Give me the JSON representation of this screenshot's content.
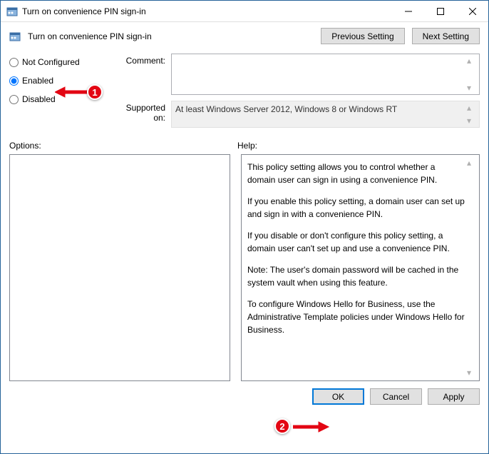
{
  "window": {
    "title": "Turn on convenience PIN sign-in"
  },
  "nav": {
    "prev": "Previous Setting",
    "next": "Next Setting"
  },
  "header": {
    "title": "Turn on convenience PIN sign-in"
  },
  "radio": {
    "not_configured": "Not Configured",
    "enabled": "Enabled",
    "disabled": "Disabled",
    "selected": "enabled"
  },
  "fields": {
    "comment_label": "Comment:",
    "comment_value": "",
    "supported_label": "Supported on:",
    "supported_value": "At least Windows Server 2012, Windows 8 or Windows RT"
  },
  "panels": {
    "options_label": "Options:",
    "help_label": "Help:",
    "help_p1": "This policy setting allows you to control whether a domain user can sign in using a convenience PIN.",
    "help_p2": "If you enable this policy setting, a domain user can set up and sign in with a convenience PIN.",
    "help_p3": "If you disable or don't configure this policy setting, a domain user can't set up and use a convenience PIN.",
    "help_p4": "Note: The user's domain password will be cached in the system vault when using this feature.",
    "help_p5": "To configure Windows Hello for Business, use the Administrative Template policies under Windows Hello for Business."
  },
  "buttons": {
    "ok": "OK",
    "cancel": "Cancel",
    "apply": "Apply"
  },
  "annotations": {
    "one": "1",
    "two": "2"
  }
}
